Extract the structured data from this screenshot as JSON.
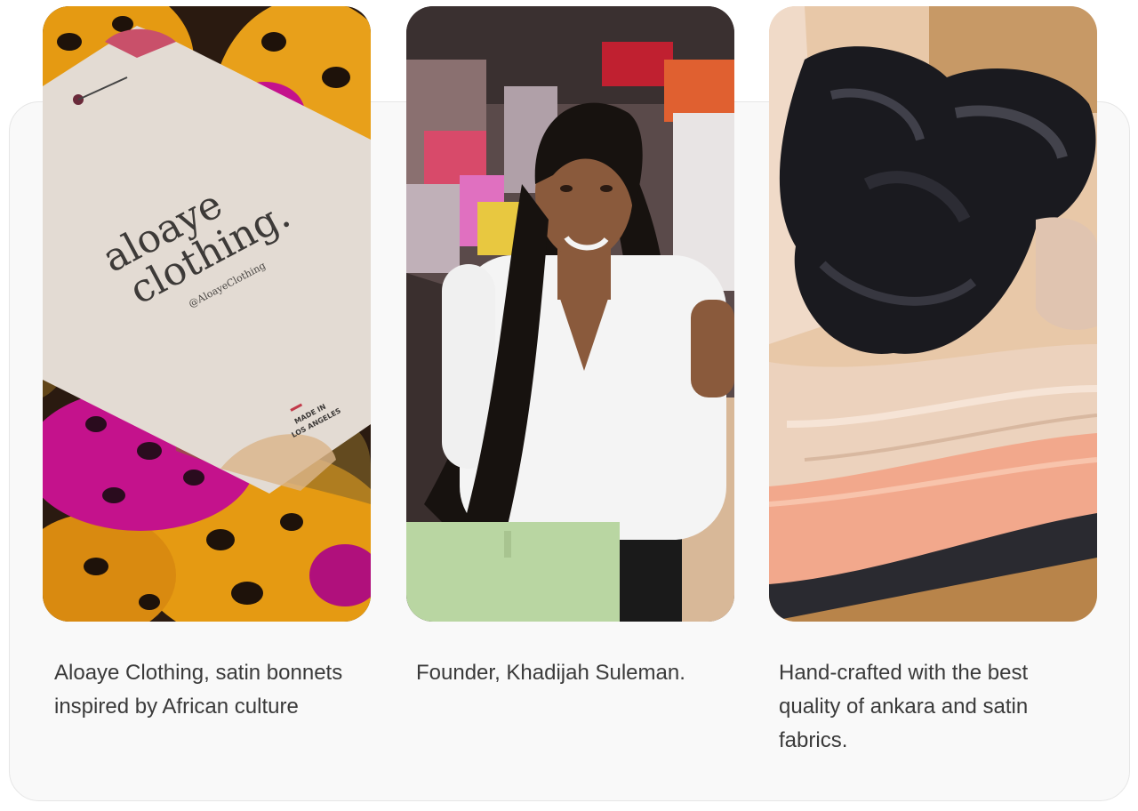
{
  "gallery": {
    "cards": [
      {
        "caption": "Aloaye Clothing, satin bonnets inspired by African culture",
        "tag_line1": "aloaye",
        "tag_line2": "clothing.",
        "tag_handle": "@AloayeClothing",
        "tag_made_line1": "MADE IN",
        "tag_made_line2": "LOS ANGELES"
      },
      {
        "caption": "Founder, Khadijah Suleman."
      },
      {
        "caption": "Hand-crafted with the best quality of ankara and satin fabrics."
      }
    ]
  },
  "colors": {
    "panel_bg": "#f9f9f9",
    "panel_border": "#e6e6e6",
    "caption_text": "#3a3a3a",
    "ankara_orange": "#e59a12",
    "ankara_magenta": "#c4128c",
    "tag_paper": "#e3dbd3",
    "satin_black": "#1a1a1f",
    "satin_champagne": "#ecd2bd",
    "satin_peach": "#f2a88c",
    "shirt_white": "#f4f4f4",
    "pants_green": "#b9d6a2"
  }
}
